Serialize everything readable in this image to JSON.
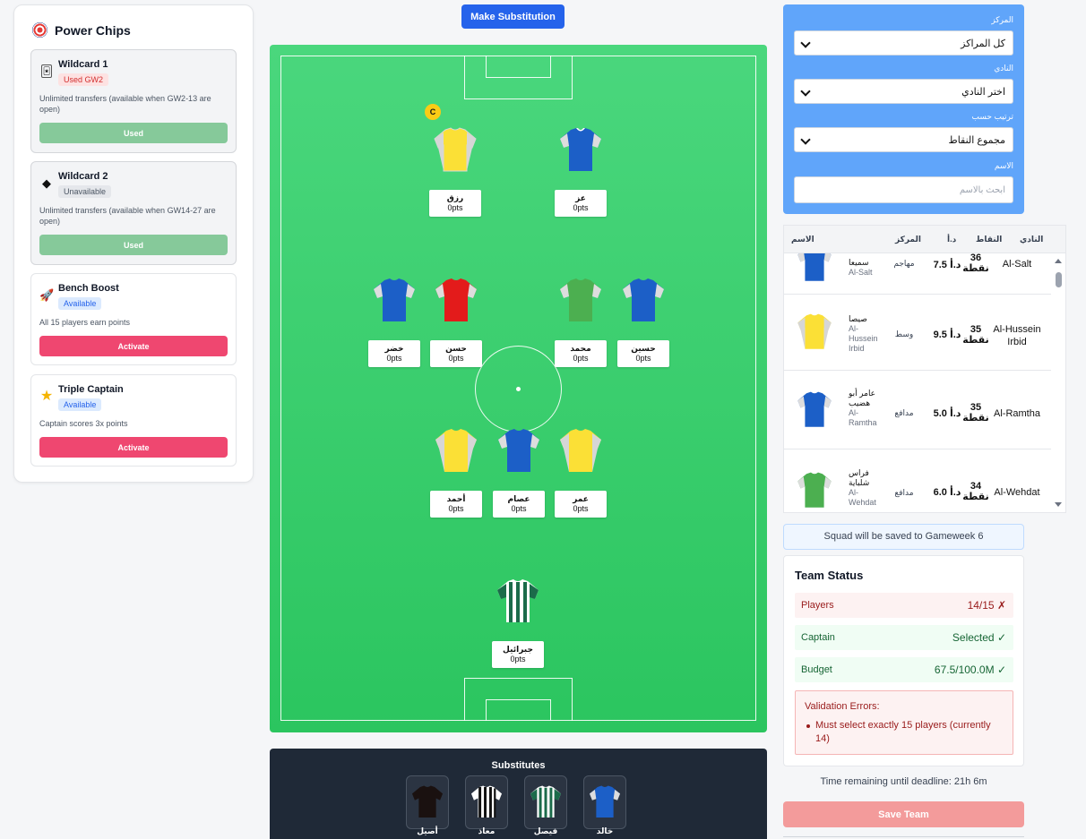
{
  "power_chips": {
    "title": "Power Chips",
    "chips": [
      {
        "name": "Wildcard 1",
        "badge": "Used GW2",
        "description": "Unlimited transfers (available when GW2-13 are open)",
        "button": "Used"
      },
      {
        "name": "Wildcard 2",
        "badge": "Unavailable",
        "description": "Unlimited transfers (available when GW14-27 are open)",
        "button": "Used"
      },
      {
        "name": "Bench Boost",
        "badge": "Available",
        "description": "All 15 players earn points",
        "button": "Activate"
      },
      {
        "name": "Triple Captain",
        "badge": "Available",
        "description": "Captain scores 3x points",
        "button": "Activate"
      }
    ]
  },
  "toolbar": {
    "make_substitution": "Make Substitution"
  },
  "pitch": {
    "captain_marker": "C",
    "players": [
      {
        "name": "رزق",
        "points": "0pts",
        "kit": "yellow"
      },
      {
        "name": "عز",
        "points": "0pts",
        "kit": "blue"
      },
      {
        "name": "خضر",
        "points": "0pts",
        "kit": "blue"
      },
      {
        "name": "حسن",
        "points": "0pts",
        "kit": "red"
      },
      {
        "name": "محمد",
        "points": "0pts",
        "kit": "green"
      },
      {
        "name": "حسين",
        "points": "0pts",
        "kit": "blue"
      },
      {
        "name": "أحمد",
        "points": "0pts",
        "kit": "yellow"
      },
      {
        "name": "عصام",
        "points": "0pts",
        "kit": "blue"
      },
      {
        "name": "عمر",
        "points": "0pts",
        "kit": "yellow"
      },
      {
        "name": "جبرائيل",
        "points": "0pts",
        "kit": "green-stripes"
      }
    ]
  },
  "substitutes": {
    "title": "Substitutes",
    "players": [
      {
        "name": "أصيل",
        "kit": "black"
      },
      {
        "name": "معاذ",
        "kit": "black-stripes"
      },
      {
        "name": "فيصل",
        "kit": "green-stripes"
      },
      {
        "name": "خالد",
        "kit": "blue"
      }
    ]
  },
  "filters": {
    "position_label": "المركز",
    "position_value": "كل المراكز",
    "club_label": "النادي",
    "club_value": "اختر النادي",
    "sort_label": "ترتيب حسب",
    "sort_value": "مجموع النقاط",
    "name_label": "الاسم",
    "name_placeholder": "ابحث بالاسم"
  },
  "player_table": {
    "headers": {
      "name": "الاسم",
      "position": "المركز",
      "price": "د.أ",
      "points": "النقاط",
      "club": "النادي"
    },
    "rows": [
      {
        "name": "سميعا",
        "club_sub": "Al-Salt",
        "position": "مهاجم",
        "price": "7.5 د.أ",
        "points": "36 نقطة",
        "club": "Al-Salt",
        "kit": "blue"
      },
      {
        "name": "صيصا",
        "club_sub": "Al-Hussein Irbid",
        "position": "وسط",
        "price": "9.5 د.أ",
        "points": "35 نقطة",
        "club": "Al-Hussein Irbid",
        "kit": "yellow"
      },
      {
        "name": "عامر أبو هضيب",
        "club_sub": "Al-Ramtha",
        "position": "مدافع",
        "price": "5.0 د.أ",
        "points": "35 نقطة",
        "club": "Al-Ramtha",
        "kit": "blue"
      },
      {
        "name": "فراس شلباية",
        "club_sub": "Al-Wehdat",
        "position": "مدافع",
        "price": "6.0 د.أ",
        "points": "34 نقطة",
        "club": "Al-Wehdat",
        "kit": "green"
      }
    ]
  },
  "save_note": "Squad will be saved to Gameweek 6",
  "team_status": {
    "title": "Team Status",
    "rows": [
      {
        "label": "Players",
        "value": "14/15 ✗"
      },
      {
        "label": "Captain",
        "value": "Selected ✓"
      },
      {
        "label": "Budget",
        "value": "67.5/100.0M ✓"
      }
    ],
    "validation_title": "Validation Errors:",
    "validation_items": [
      "Must select exactly 15 players (currently 14)"
    ]
  },
  "deadline": "Time remaining until deadline: 21h 6m",
  "save_button": "Save Team",
  "colors": {
    "accent": "#2563eb",
    "pitch": "#3ccf6e",
    "activate": "#ef4770",
    "filter_panel": "#60a5fa",
    "danger": "#991b1b",
    "success": "#166534"
  }
}
